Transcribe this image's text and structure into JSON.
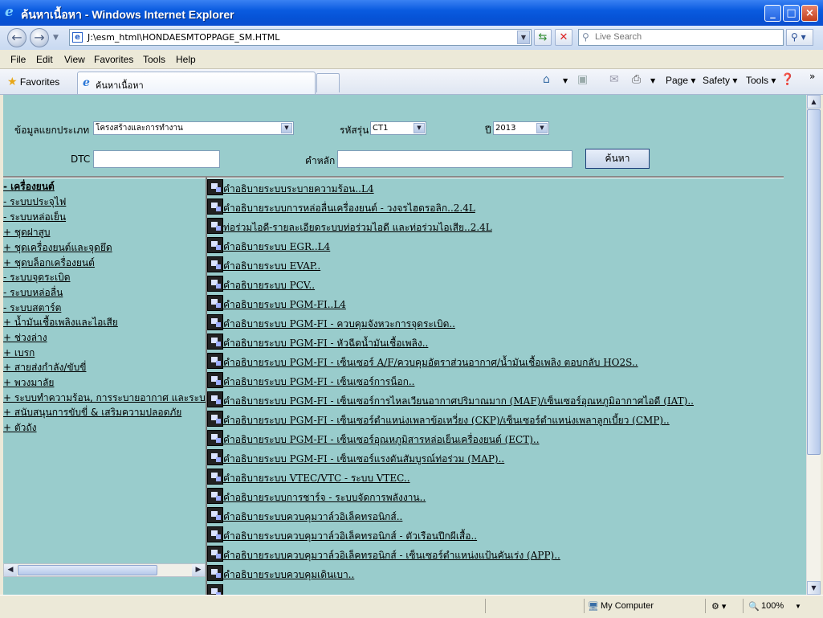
{
  "window": {
    "title": "ค้นหาเนื้อหา - Windows Internet Explorer"
  },
  "address": {
    "url": "J:\\esm_html\\HONDAESMTOPPAGE_SM.HTML",
    "search_placeholder": "Live Search"
  },
  "menu": [
    "File",
    "Edit",
    "View",
    "Favorites",
    "Tools",
    "Help"
  ],
  "tabbar": {
    "favorites": "Favorites",
    "tab_label": "ค้นหาเนื้อหา",
    "page": "Page",
    "safety": "Safety",
    "tools": "Tools"
  },
  "form": {
    "category_label": "ข้อมูลแยกประเภท",
    "category_value": "โครงสร้างและการทำงาน",
    "model_label": "รหัสรุ่น",
    "model_value": "CT1",
    "year_label": "ปี",
    "year_value": "2013",
    "dtc_label": "DTC",
    "keyword_label": "คำหลัก",
    "search_button": "ค้นหา"
  },
  "tree": [
    "- เครื่องยนต์",
    " - ระบบประจุไฟ",
    " - ระบบหล่อเย็น",
    " + ชุดฝาสูบ",
    " + ชุดเครื่องยนต์และจุดยึด",
    " + ชุดบล็อกเครื่องยนต์",
    " - ระบบจุดระเบิด",
    " - ระบบหล่อลื่น",
    " - ระบบสตาร์ต",
    "+ น้ำมันเชื้อเพลิงและไอเสีย",
    "+ ช่วงล่าง",
    "+ เบรก",
    "+ สายส่งกำลัง/ขับขี่",
    "+ พวงมาลัย",
    "+ ระบบทำความร้อน, การระบายอากาศ และระบบ",
    "+ สนับสนุนการขับขี่ & เสริมความปลอดภัย",
    "+ ตัวถัง"
  ],
  "docs": [
    "คำอธิบายระบบระบายความร้อน..L4",
    "คำอธิบายระบบการหล่อลื่นเครื่องยนต์ - วงจรไฮดรอลิก..2.4L",
    "ท่อร่วมไอดี-รายละเอียดระบบท่อร่วมไอดี และท่อร่วมไอเสีย..2.4L",
    "คำอธิบายระบบ EGR..L4",
    "คำอธิบายระบบ EVAP..",
    "คำอธิบายระบบ PCV..",
    "คำอธิบายระบบ PGM-FI..L4",
    "คำอธิบายระบบ PGM-FI - ควบคุมจังหวะการจุดระเบิด..",
    "คำอธิบายระบบ PGM-FI - หัวฉีดน้ำมันเชื้อเพลิง..",
    "คำอธิบายระบบ PGM-FI - เซ็นเซอร์ A/F/ควบคุมอัตราส่วนอากาศ/น้ำมันเชื้อเพลิง ตอบกลับ HO2S..",
    "คำอธิบายระบบ PGM-FI - เซ็นเซอร์การน็อก..",
    "คำอธิบายระบบ PGM-FI - เซ็นเซอร์การไหลเวียนอากาศปริมาณมาก (MAF)/เซ็นเซอร์อุณหภูมิอากาศไอดี (IAT)..",
    "คำอธิบายระบบ PGM-FI - เซ็นเซอร์ตำแหน่งเพลาข้อเหวี่ยง (CKP)/เซ็นเซอร์ตำแหน่งเพลาลูกเบี้ยว (CMP)..",
    "คำอธิบายระบบ PGM-FI - เซ็นเซอร์อุณหภูมิสารหล่อเย็นเครื่องยนต์ (ECT)..",
    "คำอธิบายระบบ PGM-FI - เซ็นเซอร์แรงดันสัมบูรณ์ท่อร่วม (MAP)..",
    "คำอธิบายระบบ VTEC/VTC - ระบบ VTEC..",
    "คำอธิบายระบบการชาร์จ - ระบบจัดการพลังงาน..",
    "คำอธิบายระบบควบคุมวาล์วอิเล็คทรอนิกส์..",
    "คำอธิบายระบบควบคุมวาล์วอิเล็คทรอนิกส์ - ตัวเรือนปีกผีเสื้อ..",
    "คำอธิบายระบบควบคุมวาล์วอิเล็คทรอนิกส์ - เซ็นเซอร์ตำแหน่งแป้นคันเร่ง (APP)..",
    "คำอธิบายระบบควบคุมเดินเบา.."
  ],
  "status": {
    "zone": "My Computer",
    "zoom": "100%"
  }
}
